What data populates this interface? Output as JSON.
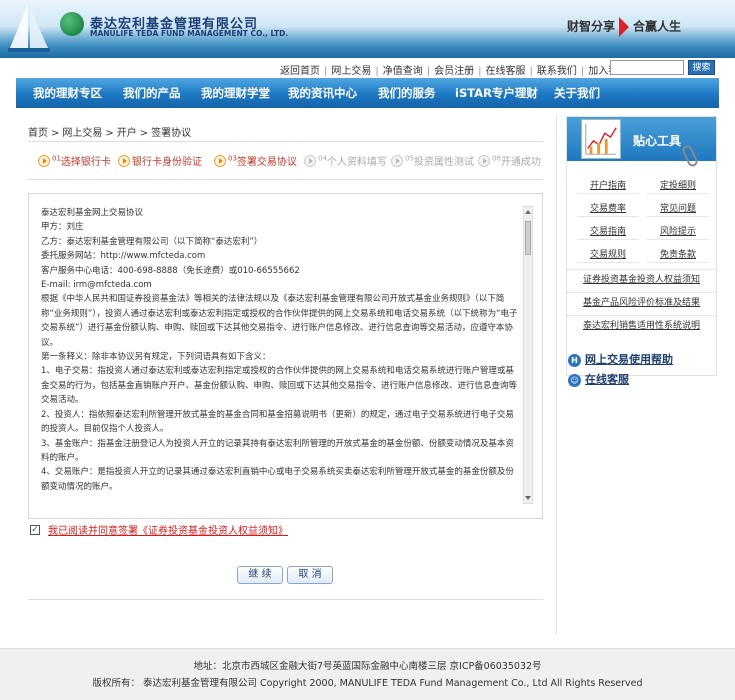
{
  "header": {
    "company_cn": "泰达宏利基金管理有限公司",
    "company_en": "MANULIFE TEDA FUND MANAGEMENT CO., LTD.",
    "slogan_left": "财智分享",
    "slogan_right": "合赢人生"
  },
  "toplinks": [
    "返回首页",
    "网上交易",
    "净值查询",
    "会员注册",
    "在线客服",
    "联系我们",
    "加入我们"
  ],
  "search": {
    "value": "",
    "button_label": "搜索"
  },
  "nav": [
    "我的理财专区",
    "我们的产品",
    "我的理财学堂",
    "我的资讯中心",
    "我们的服务",
    "iSTAR专户理财",
    "关于我们"
  ],
  "breadcrumb": [
    "首页",
    "网上交易",
    "开户",
    "签署协议"
  ],
  "steps": [
    {
      "num": "01",
      "label": "选择银行卡"
    },
    {
      "num": "",
      "label": "银行卡身份验证"
    },
    {
      "num": "03",
      "label": "签署交易协议"
    },
    {
      "num": "04",
      "label": "个人资料填写"
    },
    {
      "num": "05",
      "label": "投资属性测试"
    },
    {
      "num": "06",
      "label": "开通成功"
    }
  ],
  "agreement": {
    "lines": [
      "泰达宏利基金网上交易协议",
      "甲方：刘庄",
      "乙方：泰达宏利基金管理有限公司（以下简称“泰达宏利”）",
      "委托服务网站：http://www.mfcteda.com",
      "客户服务中心电话：400-698-8888（免长途费）或010-66555662",
      "E-mail: irm@mfcteda.com",
      "根据《中华人民共和国证券投资基金法》等相关的法律法规以及《泰达宏利基金管理有限公司开放式基金业务规则》（以下简称“业务规则”），投资人通过泰达宏利或泰达宏利指定或授权的合作伙伴提供的网上交易系统和电话交易系统（以下统称为“电子交易系统”）进行基金份额认购、申购、赎回或下达其他交易指令、进行账户信息修改、进行信息查询等交易活动，应遵守本协议。",
      "第一条释义：除非本协议另有规定，下列词语具有如下含义：",
      "1、电子交易：指投资人通过泰达宏利或泰达宏利指定或授权的合作伙伴提供的网上交易系统和电话交易系统进行账户管理或基金交易的行为，包括基金直销账户开户、基金份额认购、申购、赎回或下达其他交易指令、进行账户信息修改、进行信息查询等交易活动。",
      "2、投资人：指依照泰达宏利所管理开放式基金的基金合同和基金招募说明书（更新）的规定，通过电子交易系统进行电子交易的投资人。目前仅指个人投资人。",
      "3、基金账户：指基金注册登记人为投资人开立的记录其持有泰达宏利所管理的开放式基金的基金份额、份额变动情况及基本资料的账户。",
      "4、交易账户：是指投资人开立的记录其通过泰达宏利直销中心或电子交易系统买卖泰达宏利所管理开放式基金的基金份额及份额变动情况的账户。"
    ]
  },
  "consent": {
    "checked": true,
    "checkmark": "✓",
    "label": "我已阅读并同意签署《证券投资基金投资人权益须知》"
  },
  "buttons": {
    "continue": "继 续",
    "cancel": "取 消"
  },
  "sidebar": {
    "title": "贴心工具",
    "grid": [
      "开户指南",
      "定投细则",
      "交易费率",
      "常见问题",
      "交易指南",
      "风险提示",
      "交易规则",
      "免责条款"
    ],
    "rows": [
      "证券投资基金投资人权益须知",
      "基金产品风险评价标准及结果",
      "泰达宏利销售适用性系统说明"
    ]
  },
  "help_links": [
    {
      "icon": "H",
      "label": "网上交易使用帮助"
    },
    {
      "icon": "",
      "label": "在线客服"
    }
  ],
  "footer": {
    "address": "地址：北京市西城区金融大街7号英蓝国际金融中心南楼三层 京ICP备06035032号",
    "copyright": "版权所有：  泰达宏利基金管理有限公司  Copyright 2000, MANULIFE TEDA Fund Management Co., Ltd All Rights Reserved"
  },
  "colors": {
    "nav_blue": "#1e78c3",
    "accent_red": "#d21c1c",
    "step_orange": "#f08010"
  }
}
